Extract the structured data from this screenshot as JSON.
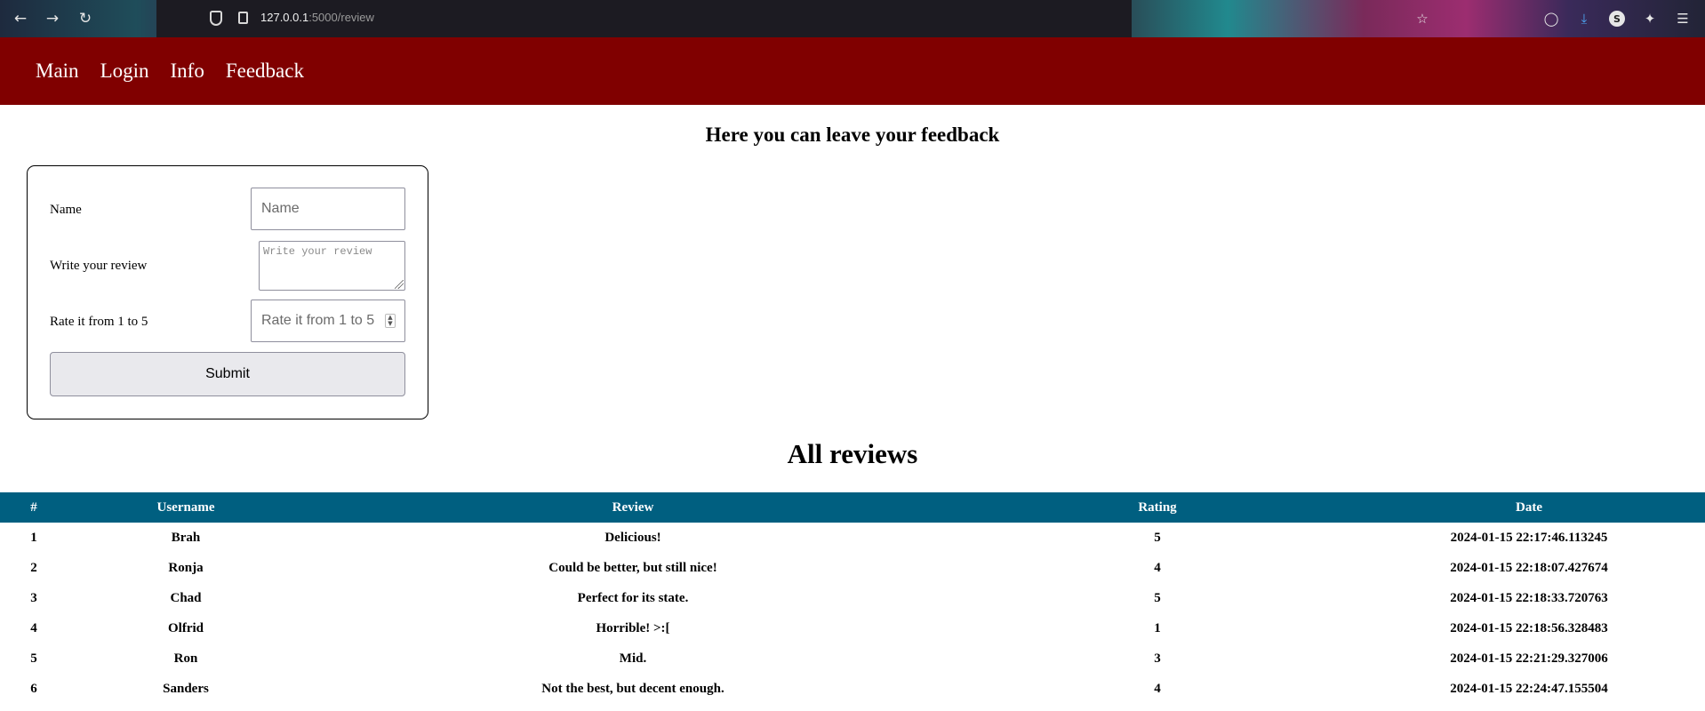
{
  "browser": {
    "url_host": "127.0.0.1",
    "url_path": ":5000/review",
    "avatar_letter": "S"
  },
  "nav": {
    "items": [
      "Main",
      "Login",
      "Info",
      "Feedback"
    ]
  },
  "form": {
    "title": "Here you can leave your feedback",
    "name_label": "Name",
    "name_placeholder": "Name",
    "review_label": "Write your review",
    "review_placeholder": "Write your review",
    "rating_label": "Rate it from 1 to 5",
    "rating_placeholder": "Rate it from 1 to 5",
    "submit_label": "Submit"
  },
  "reviews": {
    "title": "All reviews",
    "columns": [
      "#",
      "Username",
      "Review",
      "Rating",
      "Date"
    ],
    "rows": [
      [
        "1",
        "Brah",
        "Delicious!",
        "5",
        "2024-01-15 22:17:46.113245"
      ],
      [
        "2",
        "Ronja",
        "Could be better, but still nice!",
        "4",
        "2024-01-15 22:18:07.427674"
      ],
      [
        "3",
        "Chad",
        "Perfect for its state.",
        "5",
        "2024-01-15 22:18:33.720763"
      ],
      [
        "4",
        "Olfrid",
        "Horrible! >:[",
        "1",
        "2024-01-15 22:18:56.328483"
      ],
      [
        "5",
        "Ron",
        "Mid.",
        "3",
        "2024-01-15 22:21:29.327006"
      ],
      [
        "6",
        "Sanders",
        "Not the best, but decent enough.",
        "4",
        "2024-01-15 22:24:47.155504"
      ]
    ]
  },
  "colors": {
    "nav_bg": "#800000",
    "table_header_bg": "#005f80"
  }
}
